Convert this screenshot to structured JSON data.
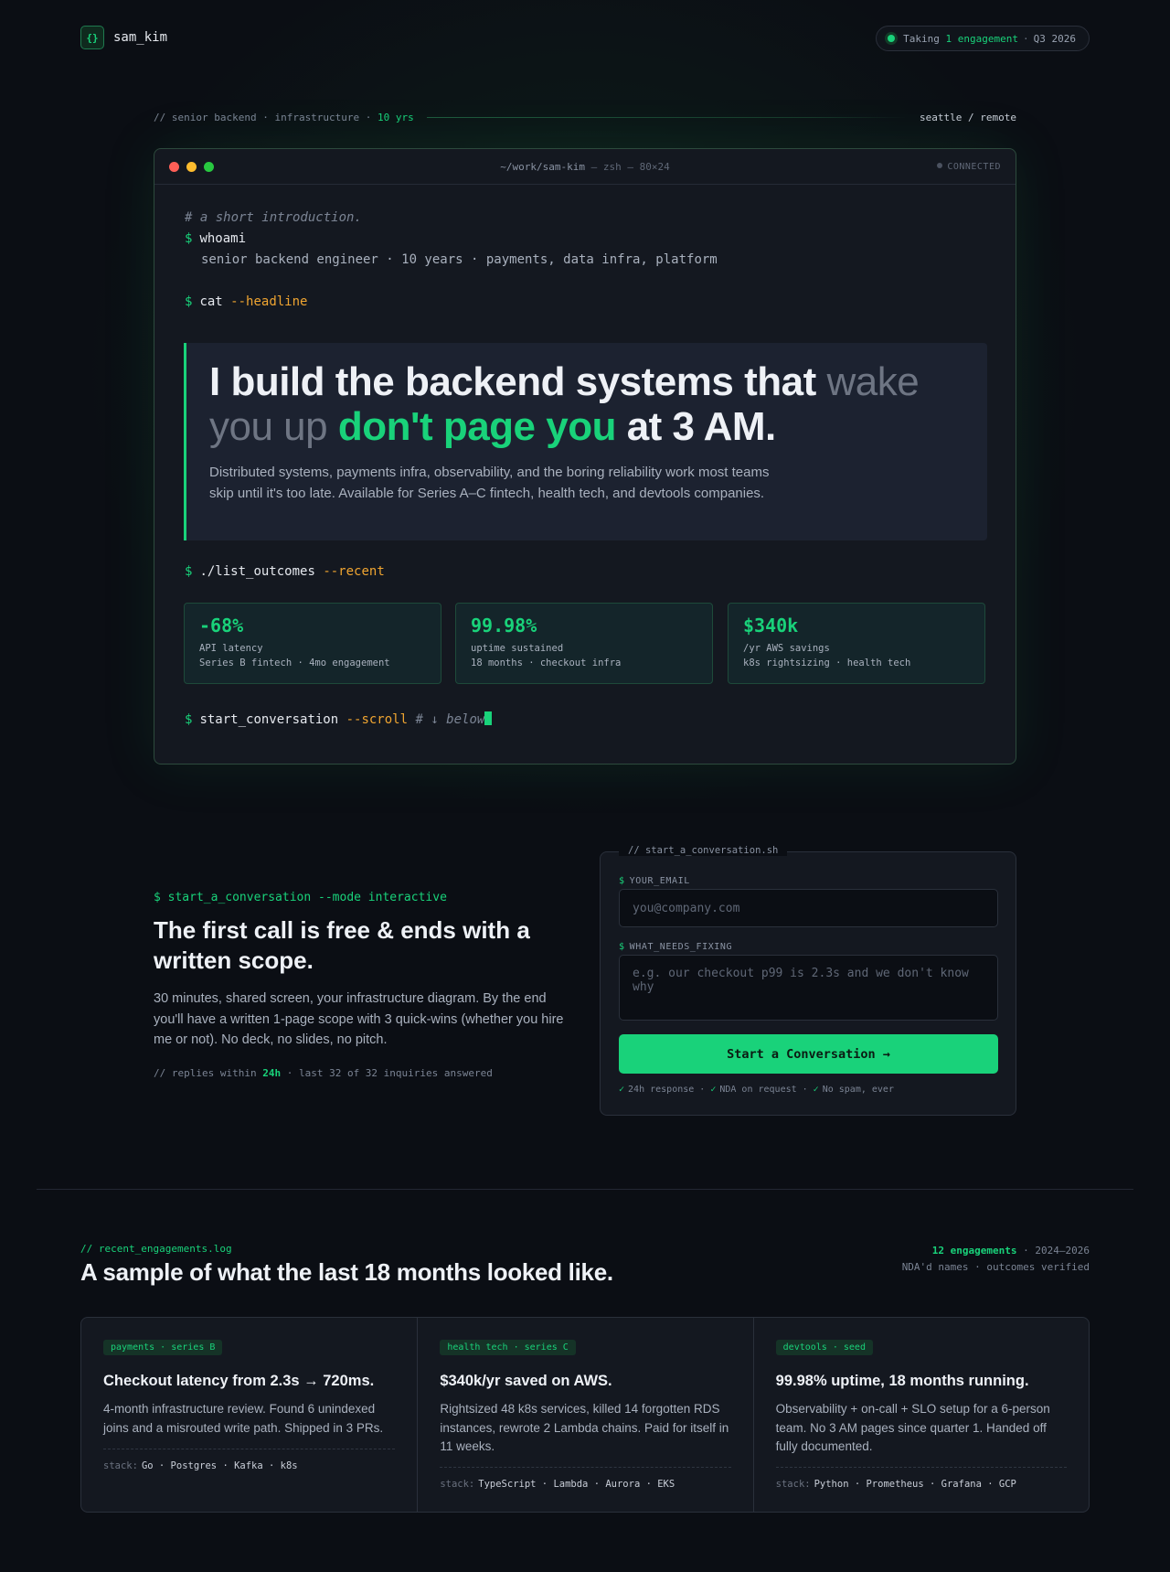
{
  "header": {
    "logo_icon": "{}",
    "brand": "sam_kim",
    "status_prefix": "Taking",
    "status_highlight": "1 engagement",
    "status_suffix": "Q3 2026"
  },
  "intro": {
    "left_prefix": "// senior backend · infrastructure ·",
    "left_highlight": "10 yrs",
    "right": "seattle / remote"
  },
  "terminal": {
    "title_path": "~/work/sam-kim",
    "title_rest": "— zsh — 80×24",
    "connection": "CONNECTED",
    "comment": "# a short introduction.",
    "prompt": "$",
    "cmd1": "whoami",
    "cmd1_output": "senior backend engineer · 10 years · payments, data infra, platform",
    "cmd2": "cat",
    "cmd2_flag": "--headline",
    "headline_a": "I build the backend systems that ",
    "headline_strike": "wake you up",
    "headline_hl": "don't page you",
    "headline_b": " at 3 AM.",
    "headline_sub": "Distributed systems, payments infra, observability, and the boring reliability work most teams skip until it's too late. Available for Series A–C fintech, health tech, and devtools companies.",
    "cmd3": "./list_outcomes",
    "cmd3_flag": "--recent",
    "stats": [
      {
        "value": "-68%",
        "line1": "API latency",
        "line2": "Series B fintech · 4mo engagement"
      },
      {
        "value": "99.98%",
        "line1": "uptime sustained",
        "line2": "18 months · checkout infra"
      },
      {
        "value": "$340k",
        "line1": "/yr AWS savings",
        "line2": "k8s rightsizing · health tech"
      }
    ],
    "cmd4": "start_conversation",
    "cmd4_flag": "--scroll",
    "cmd4_comment": "# ↓ below"
  },
  "conversation": {
    "cmd": "$ start_a_conversation --mode interactive",
    "title": "The first call is free & ends with a written scope.",
    "body": "30 minutes, shared screen, your infrastructure diagram. By the end you'll have a written 1-page scope with 3 quick-wins (whether you hire me or not). No deck, no slides, no pitch.",
    "foot_prefix": "//  replies within",
    "foot_highlight": "24h",
    "foot_suffix": "· last 32 of 32 inquiries answered"
  },
  "form": {
    "tab": "// start_a_conversation.sh",
    "email_label": "YOUR_EMAIL",
    "email_placeholder": "you@company.com",
    "fix_label": "WHAT_NEEDS_FIXING",
    "fix_placeholder": "e.g. our checkout p99 is 2.3s and we don't know why",
    "submit": "Start a Conversation →",
    "notes": [
      "24h response",
      "NDA on request",
      "No spam, ever"
    ]
  },
  "engagements": {
    "tag": "// recent_engagements.log",
    "title": "A sample of what the last 18 months looked like.",
    "meta_highlight": "12 engagements",
    "meta_range": "· 2024–2026",
    "meta_line2": "NDA'd names · outcomes verified",
    "stack_label": "stack:",
    "cards": [
      {
        "chip": "payments · series B",
        "title": "Checkout latency from 2.3s → 720ms.",
        "body": "4-month infrastructure review. Found 6 unindexed joins and a misrouted write path. Shipped in 3 PRs.",
        "stack": "Go · Postgres · Kafka · k8s"
      },
      {
        "chip": "health tech · series C",
        "title": "$340k/yr saved on AWS.",
        "body": "Rightsized 48 k8s services, killed 14 forgotten RDS instances, rewrote 2 Lambda chains. Paid for itself in 11 weeks.",
        "stack": "TypeScript · Lambda · Aurora · EKS"
      },
      {
        "chip": "devtools · seed",
        "title": "99.98% uptime, 18 months running.",
        "body": "Observability + on-call + SLO setup for a 6-person team. No 3 AM pages since quarter 1. Handed off fully documented.",
        "stack": "Python · Prometheus · Grafana · GCP"
      }
    ]
  }
}
